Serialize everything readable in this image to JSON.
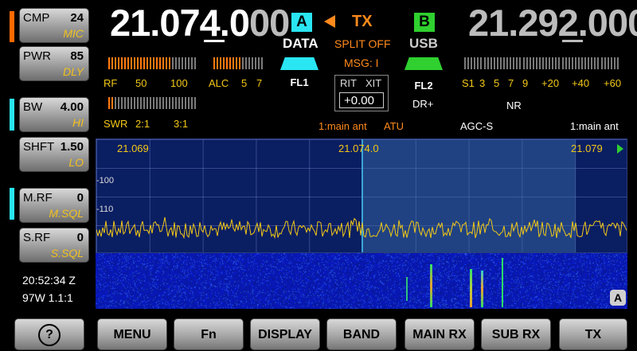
{
  "side_buttons": [
    {
      "id": "cmp",
      "name": "CMP",
      "value": "24",
      "sub": "MIC"
    },
    {
      "id": "pwr",
      "name": "PWR",
      "value": "85",
      "sub": "DLY"
    },
    {
      "id": "bw",
      "name": "BW",
      "value": "4.00",
      "sub": "HI"
    },
    {
      "id": "shft",
      "name": "SHFT",
      "value": "1.50",
      "sub": "LO"
    },
    {
      "id": "mrf",
      "name": "M.RF",
      "value": "0",
      "sub": "M.SQL"
    },
    {
      "id": "srf",
      "name": "S.RF",
      "value": "0",
      "sub": "S.SQL"
    }
  ],
  "clock": {
    "time": "20:52:34 Z",
    "grid": "97W 1.1:1"
  },
  "vfo_a": {
    "freq_main": "21.074.",
    "freq_mid": "0",
    "freq_dim": "00",
    "label": "A",
    "mode": "DATA",
    "filter": "FL1"
  },
  "vfo_b": {
    "freq": "21.292.000",
    "label": "B",
    "mode": "USB",
    "filter": "FL2",
    "dr": "DR+"
  },
  "tx": {
    "label": "TX",
    "split": "SPLIT OFF",
    "msg": "MSG: I"
  },
  "rit": {
    "rit": "RIT",
    "xit": "XIT",
    "value": "+0.00"
  },
  "meters": {
    "rf": {
      "labels": [
        "RF",
        "50",
        "100"
      ]
    },
    "alc": {
      "labels": [
        "ALC",
        "5",
        "7"
      ]
    },
    "swr": {
      "labels": [
        "SWR",
        "2:1",
        "3:1"
      ]
    },
    "s": {
      "labels": [
        "S1",
        "3",
        "5",
        "7",
        "9",
        "+20",
        "+40",
        "+60"
      ]
    }
  },
  "status": {
    "ant_a": "1:main ant",
    "atu": "ATU",
    "agc": "AGC-S",
    "nr": "NR",
    "ant_b": "1:main ant"
  },
  "spectrum": {
    "f_left": "21.069",
    "f_center": "21.074.0",
    "f_right": "21.079",
    "ref_100": "-100",
    "ref_110": "-110",
    "badge": "A"
  },
  "bottom": {
    "help": "?",
    "menu": "MENU",
    "fn": "Fn",
    "display": "DISPLAY",
    "band": "BAND",
    "main_rx": "MAIN RX",
    "sub_rx": "SUB RX",
    "tx": "TX"
  },
  "colors": {
    "accent_orange": "#ff6600",
    "accent_cyan": "#29e6f2",
    "accent_green": "#2fd02f",
    "label_yellow": "#f2c816"
  }
}
